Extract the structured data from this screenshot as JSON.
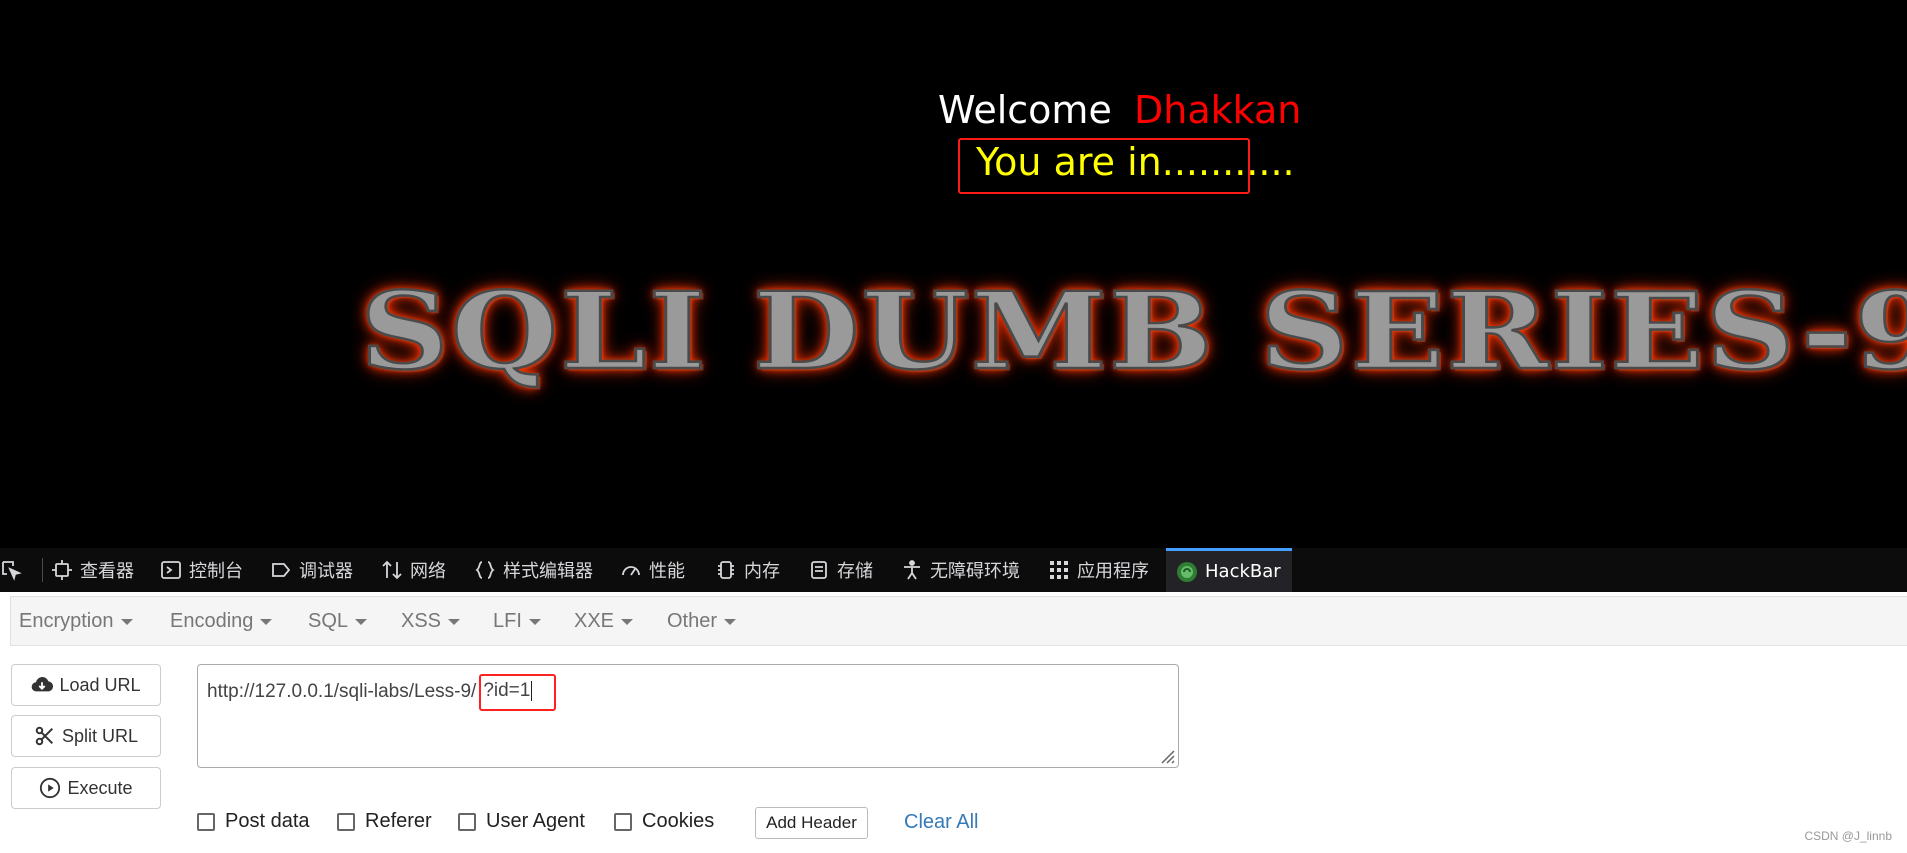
{
  "page": {
    "welcome": "Welcome",
    "user": "Dhakkan",
    "status": "You are in...........",
    "banner": "SQLI DUMB SERIES-9",
    "colors": {
      "background": "#000000",
      "welcome": "#ffffff",
      "user": "#ff0000",
      "status": "#ffff00",
      "banner_glow": "#ff4400"
    }
  },
  "devtools": {
    "tabs": [
      {
        "label": "查看器",
        "icon": "inspector-icon"
      },
      {
        "label": "控制台",
        "icon": "console-icon"
      },
      {
        "label": "调试器",
        "icon": "debugger-icon"
      },
      {
        "label": "网络",
        "icon": "network-icon"
      },
      {
        "label": "样式编辑器",
        "icon": "style-editor-icon"
      },
      {
        "label": "性能",
        "icon": "performance-icon"
      },
      {
        "label": "内存",
        "icon": "memory-icon"
      },
      {
        "label": "存储",
        "icon": "storage-icon"
      },
      {
        "label": "无障碍环境",
        "icon": "accessibility-icon"
      },
      {
        "label": "应用程序",
        "icon": "application-icon"
      },
      {
        "label": "HackBar",
        "icon": "hackbar-icon",
        "active": true
      }
    ]
  },
  "hackbar": {
    "menus": [
      "Encryption",
      "Encoding",
      "SQL",
      "XSS",
      "LFI",
      "XXE",
      "Other"
    ],
    "buttons": {
      "load": "Load URL",
      "split": "Split URL",
      "execute": "Execute"
    },
    "url_base": "http://127.0.0.1/sqli-labs/Less-9/",
    "url_query": "?id=1",
    "options": {
      "post": "Post data",
      "referer": "Referer",
      "useragent": "User Agent",
      "cookies": "Cookies"
    },
    "add_header": "Add Header",
    "clear_all": "Clear All"
  },
  "watermark": "CSDN @J_linnb"
}
